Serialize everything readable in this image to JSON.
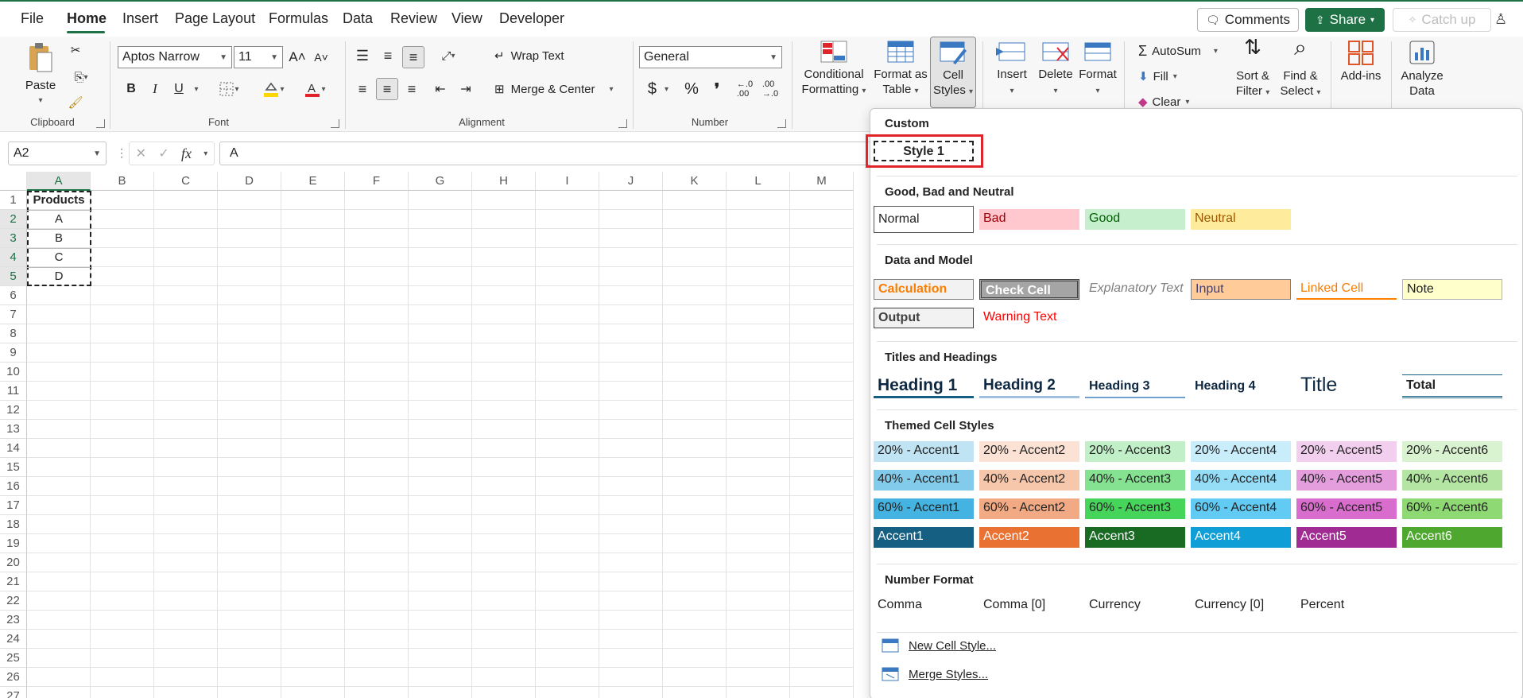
{
  "tabs": [
    "File",
    "Home",
    "Insert",
    "Page Layout",
    "Formulas",
    "Data",
    "Review",
    "View",
    "Developer"
  ],
  "top_right": {
    "comments": "Comments",
    "share": "Share",
    "catch_up": "Catch up"
  },
  "ribbon": {
    "clipboard": {
      "label": "Clipboard",
      "paste": "Paste"
    },
    "font": {
      "label": "Font",
      "name": "Aptos Narrow",
      "size": "11",
      "bold": "B",
      "italic": "I",
      "underline": "U"
    },
    "alignment": {
      "label": "Alignment",
      "wrap": "Wrap Text",
      "merge": "Merge & Center"
    },
    "number": {
      "label": "Number",
      "format": "General",
      "currency": "$",
      "percent": "%",
      "comma": "❜"
    },
    "styles": {
      "conditional": [
        "Conditional",
        "Formatting"
      ],
      "format_table": [
        "Format as",
        "Table"
      ],
      "cell_styles": [
        "Cell",
        "Styles"
      ]
    },
    "cells": {
      "insert": "Insert",
      "delete": "Delete",
      "format": "Format"
    },
    "editing": {
      "autosum": "AutoSum",
      "fill": "Fill",
      "clear": "Clear",
      "sort": [
        "Sort &",
        "Filter"
      ],
      "find": [
        "Find &",
        "Select"
      ]
    },
    "addins": "Add-ins",
    "analyze": [
      "Analyze",
      "Data"
    ]
  },
  "formula_bar": {
    "name_box": "A2",
    "fx": "fx",
    "content": "A"
  },
  "grid": {
    "columns": [
      "A",
      "B",
      "C",
      "D",
      "E",
      "F",
      "G",
      "H",
      "I",
      "J",
      "K",
      "L",
      "M"
    ],
    "rows": [
      "1",
      "2",
      "3",
      "4",
      "5",
      "6",
      "7",
      "8",
      "9",
      "10",
      "11",
      "12",
      "13",
      "14",
      "15",
      "16",
      "17",
      "18",
      "19",
      "20",
      "21",
      "22",
      "23",
      "24",
      "25",
      "26",
      "27"
    ],
    "cells": {
      "A1": "Products",
      "A2": "A",
      "A3": "B",
      "A4": "C",
      "A5": "D"
    }
  },
  "cell_styles": {
    "custom": {
      "title": "Custom",
      "items": [
        "Style 1"
      ]
    },
    "good_bad": {
      "title": "Good, Bad and Neutral",
      "items": [
        "Normal",
        "Bad",
        "Good",
        "Neutral"
      ]
    },
    "data_model": {
      "title": "Data and Model",
      "items": [
        "Calculation",
        "Check Cell",
        "Explanatory Text",
        "Input",
        "Linked Cell",
        "Note",
        "Output",
        "Warning Text"
      ]
    },
    "titles": {
      "title": "Titles and Headings",
      "items": [
        "Heading 1",
        "Heading 2",
        "Heading 3",
        "Heading 4",
        "Title",
        "Total"
      ]
    },
    "themed": {
      "title": "Themed Cell Styles",
      "rows": [
        [
          "20% - Accent1",
          "20% - Accent2",
          "20% - Accent3",
          "20% - Accent4",
          "20% - Accent5",
          "20% - Accent6"
        ],
        [
          "40% - Accent1",
          "40% - Accent2",
          "40% - Accent3",
          "40% - Accent4",
          "40% - Accent5",
          "40% - Accent6"
        ],
        [
          "60% - Accent1",
          "60% - Accent2",
          "60% - Accent3",
          "60% - Accent4",
          "60% - Accent5",
          "60% - Accent6"
        ],
        [
          "Accent1",
          "Accent2",
          "Accent3",
          "Accent4",
          "Accent5",
          "Accent6"
        ]
      ]
    },
    "number_format": {
      "title": "Number Format",
      "items": [
        "Comma",
        "Comma [0]",
        "Currency",
        "Currency [0]",
        "Percent"
      ]
    },
    "menu": {
      "new_style": "New Cell Style...",
      "merge_styles": "Merge Styles..."
    }
  },
  "colors": {
    "accent": "#1e7145",
    "highlight": "#e0242b"
  }
}
